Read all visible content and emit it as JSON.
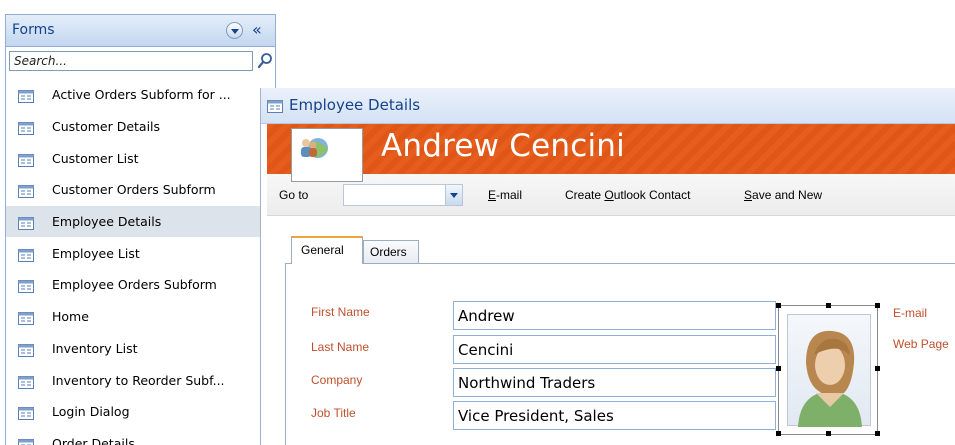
{
  "nav": {
    "title": "Forms",
    "collapse_glyph": "«",
    "search": {
      "placeholder": "Search...",
      "value": ""
    },
    "items": [
      {
        "label": "Active Orders Subform for ..."
      },
      {
        "label": "Customer Details"
      },
      {
        "label": "Customer List"
      },
      {
        "label": "Customer Orders Subform"
      },
      {
        "label": "Employee Details",
        "selected": true
      },
      {
        "label": "Employee List"
      },
      {
        "label": "Employee Orders Subform"
      },
      {
        "label": "Home"
      },
      {
        "label": "Inventory List"
      },
      {
        "label": "Inventory to Reorder Subf..."
      },
      {
        "label": "Login Dialog"
      },
      {
        "label": "Order Details"
      }
    ]
  },
  "window": {
    "title": "Employee Details"
  },
  "form": {
    "name": "Andrew Cencini",
    "goto_label": "Go to",
    "goto_value": "",
    "links": {
      "email": "E-mail",
      "outlook": "Create Outlook Contact",
      "save_new": "Save and New"
    },
    "tabs": [
      {
        "label": "General",
        "active": true
      },
      {
        "label": "Orders",
        "active": false
      }
    ],
    "fields": {
      "first_name": {
        "label": "First Name",
        "value": "Andrew"
      },
      "last_name": {
        "label": "Last Name",
        "value": "Cencini"
      },
      "company": {
        "label": "Company",
        "value": "Northwind Traders"
      },
      "job_title": {
        "label": "Job Title",
        "value": "Vice President, Sales"
      },
      "email": {
        "label": "E-mail"
      },
      "web_page": {
        "label": "Web Page"
      }
    }
  },
  "colors": {
    "header_orange": "#e55e1d",
    "label_orange": "#c0502c",
    "nav_title_blue": "#15428b",
    "selected_row": "#dde3ea"
  },
  "icons": {
    "nav_item": "form-icon",
    "search": "search-icon",
    "dropdown": "chevron-down-icon",
    "collapse": "collapse-double-chevron-icon",
    "avatar": "employee-group-icon",
    "photo": "person-photo-icon"
  }
}
